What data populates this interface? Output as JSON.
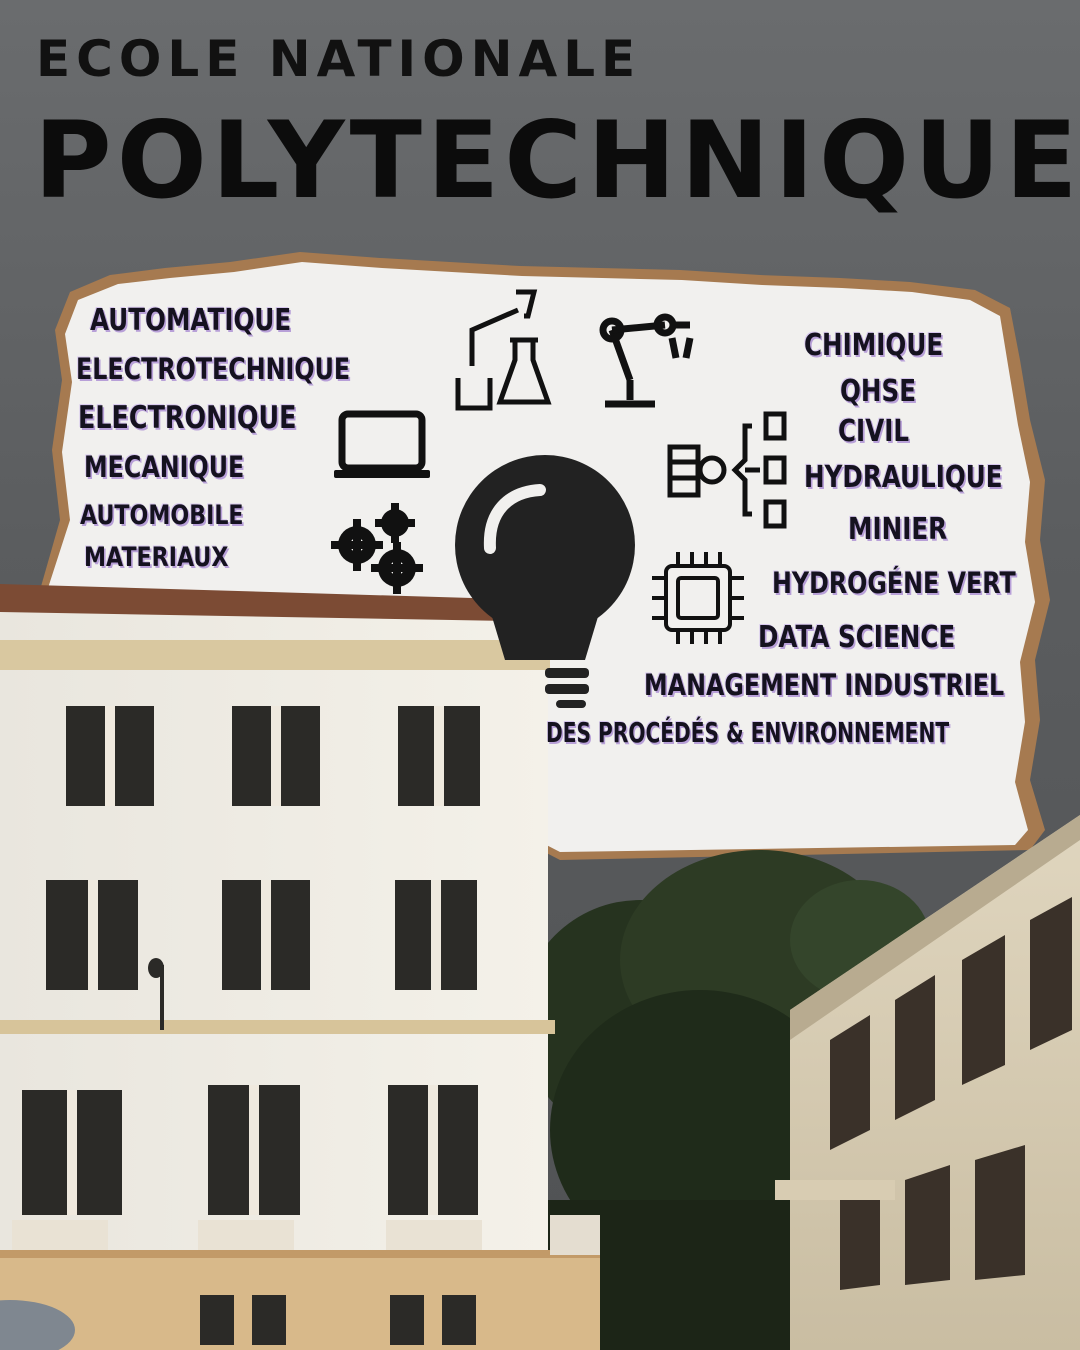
{
  "title": {
    "line1": "ECOLE NATIONALE",
    "line2": "POLYTECHNIQUE"
  },
  "specialties_left": [
    "AUTOMATIQUE",
    "ELECTROTECHNIQUE",
    "ELECTRONIQUE",
    "MECANIQUE",
    "AUTOMOBILE",
    "MATERIAUX"
  ],
  "specialties_right": [
    "CHIMIQUE",
    "QHSE",
    "CIVIL",
    "HYDRAULIQUE",
    "MINIER",
    "HYDROGÉNE VERT",
    "DATA SCIENCE",
    "MANAGEMENT INDUSTRIEL",
    "DES PROCÉDÉS & ENVIRONNEMENT"
  ],
  "icons": [
    "laptop-icon",
    "gears-icon",
    "chemistry-flask-icon",
    "robot-arm-icon",
    "lightbulb-icon",
    "data-hierarchy-icon",
    "microchip-icon"
  ],
  "colors": {
    "sky": "#5d5f61",
    "paper": "#f1f0ee",
    "torn_edge": "#b08660",
    "text": "#15121f",
    "text_shadow": "#b8a0d8"
  }
}
